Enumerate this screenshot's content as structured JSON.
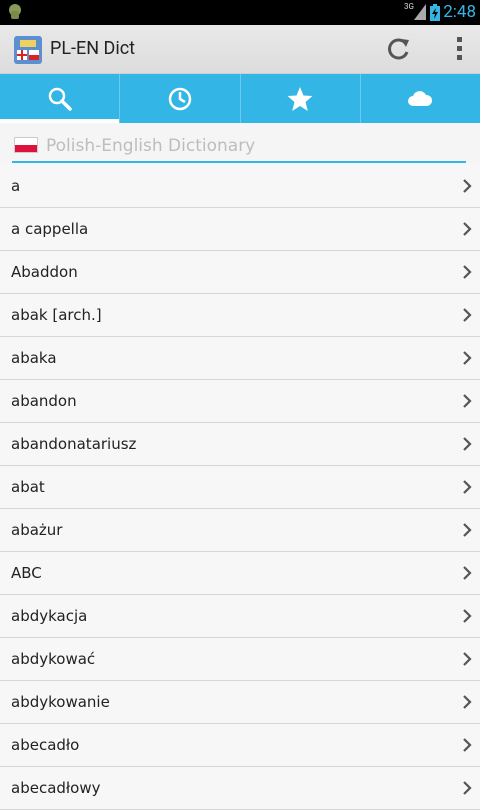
{
  "status_bar": {
    "time": "2:48",
    "network": "3G"
  },
  "app": {
    "title": "PL-EN Dict"
  },
  "tabs": [
    {
      "name": "search",
      "icon": "search-icon"
    },
    {
      "name": "history",
      "icon": "clock-icon"
    },
    {
      "name": "favorites",
      "icon": "star-icon"
    },
    {
      "name": "cloud",
      "icon": "cloud-icon"
    }
  ],
  "search": {
    "placeholder": "Polish-English Dictionary",
    "value": ""
  },
  "words": [
    "a",
    "a cappella",
    "Abaddon",
    "abak [arch.]",
    "abaka",
    "abandon",
    "abandonatariusz",
    "abat",
    "abażur",
    "ABC",
    "abdykacja",
    "abdykować",
    "abdykowanie",
    "abecadło",
    "abecadłowy"
  ],
  "colors": {
    "accent": "#33b5e5"
  }
}
